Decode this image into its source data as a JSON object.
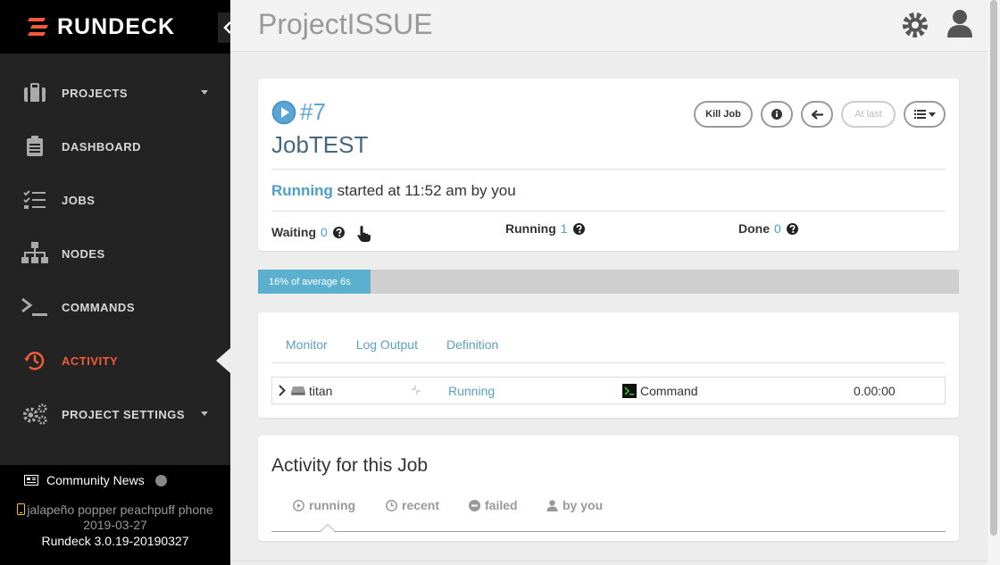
{
  "brand": {
    "name": "RUNDECK"
  },
  "sidebar": {
    "items": [
      {
        "label": "PROJECTS",
        "icon": "briefcase-icon"
      },
      {
        "label": "DASHBOARD",
        "icon": "clipboard-icon"
      },
      {
        "label": "JOBS",
        "icon": "checklist-icon"
      },
      {
        "label": "NODES",
        "icon": "sitemap-icon"
      },
      {
        "label": "COMMANDS",
        "icon": "terminal-icon"
      },
      {
        "label": "ACTIVITY",
        "icon": "history-icon",
        "active": true
      },
      {
        "label": "PROJECT SETTINGS",
        "icon": "gears-icon"
      }
    ],
    "news": "Community News",
    "version_line1": "jalapeño popper peachpuff phone",
    "version_line2": "2019-03-27",
    "version_line3": "Rundeck 3.0.19-20190327"
  },
  "header": {
    "project": "ProjectISSUE"
  },
  "execution": {
    "number": "#7",
    "job_name": "JobTEST",
    "buttons": {
      "kill": "Kill Job",
      "at_last": "At last"
    },
    "status_word": "Running",
    "status_rest": " started at 11:52 am by you",
    "counts": {
      "waiting_label": "Waiting",
      "waiting": "0",
      "running_label": "Running",
      "running": "1",
      "done_label": "Done",
      "done": "0"
    },
    "progress": {
      "percent": 16,
      "label": "16% of average 6s"
    }
  },
  "tabs": [
    "Monitor",
    "Log Output",
    "Definition"
  ],
  "node": {
    "name": "titan",
    "status": "Running",
    "step": "Command",
    "duration": "0.00:00"
  },
  "activity": {
    "title": "Activity for this Job",
    "tabs": [
      "running",
      "recent",
      "failed",
      "by you"
    ]
  },
  "colors": {
    "accent": "#f35a38",
    "link": "#5aa0c8",
    "sidebar": "#232323"
  }
}
